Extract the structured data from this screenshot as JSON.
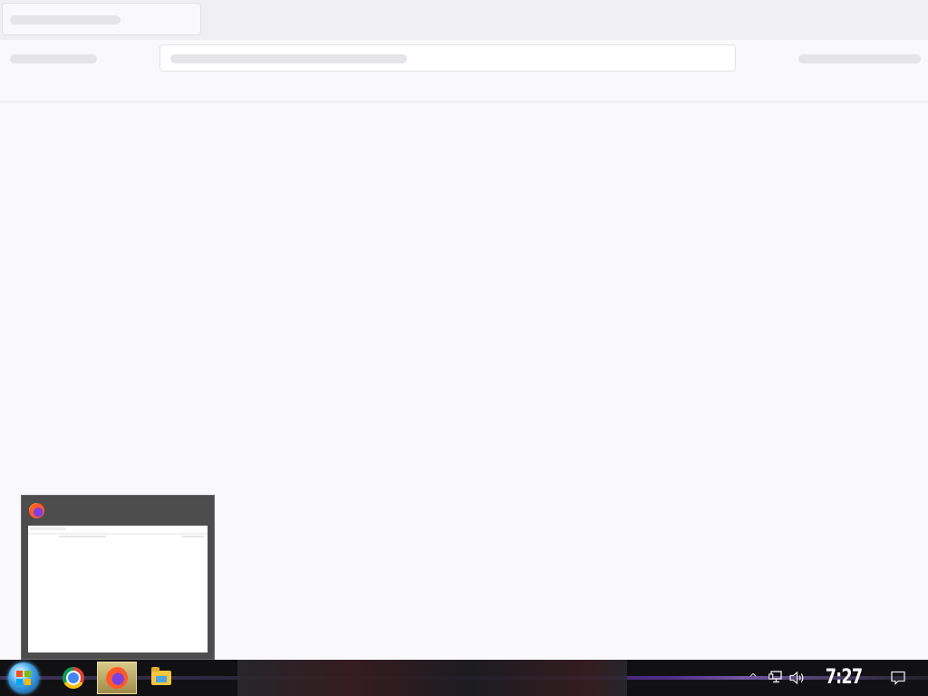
{
  "browser": {
    "loading": true
  },
  "preview": {
    "app_icon": "firefox-icon"
  },
  "taskbar": {
    "start_icon": "windows-start-icon",
    "pinned": [
      {
        "name": "chrome",
        "icon": "chrome-icon",
        "active": false
      },
      {
        "name": "firefox",
        "icon": "firefox-icon",
        "active": true
      },
      {
        "name": "file-explorer",
        "icon": "folder-icon",
        "active": false
      }
    ],
    "tray": {
      "chevron": "^",
      "icons": [
        "network-icon",
        "volume-icon",
        "notification-icon"
      ],
      "clock": "7:27 AM"
    }
  },
  "colors": {
    "page_bg": "#f9f9fb",
    "skeleton": "#e4e4e9",
    "taskbar_bg": "#111114",
    "active_button": "#d8c98a"
  }
}
